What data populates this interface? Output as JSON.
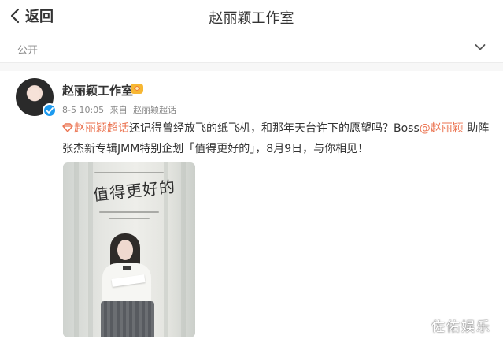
{
  "header": {
    "back_label": "返回",
    "title": "赵丽颖工作室"
  },
  "visibility": {
    "label": "公开"
  },
  "post": {
    "author": "赵丽颖工作室",
    "time": "8-5 10:05",
    "source_prefix": "来自",
    "source": "赵丽颖超话",
    "topic_link": "赵丽颖超话",
    "text_part1": "还记得曾经放飞的纸飞机，和那年天台许下的愿望吗？Boss",
    "mention": "@赵丽颖",
    "text_part2": " 助阵张杰新专辑JMM特别企划「值得更好的」，8月9日，与你相见！",
    "image_title": "值得更好的"
  },
  "watermark": "佐佑娱乐",
  "colors": {
    "link": "#eb7350",
    "verified": "#1d9bf0"
  },
  "icons": {
    "back": "chevron-left-icon",
    "dropdown": "chevron-down-icon",
    "verified": "verified-check-icon",
    "badge": "gold-fan-badge-icon",
    "topic": "supertopic-diamond-icon"
  }
}
